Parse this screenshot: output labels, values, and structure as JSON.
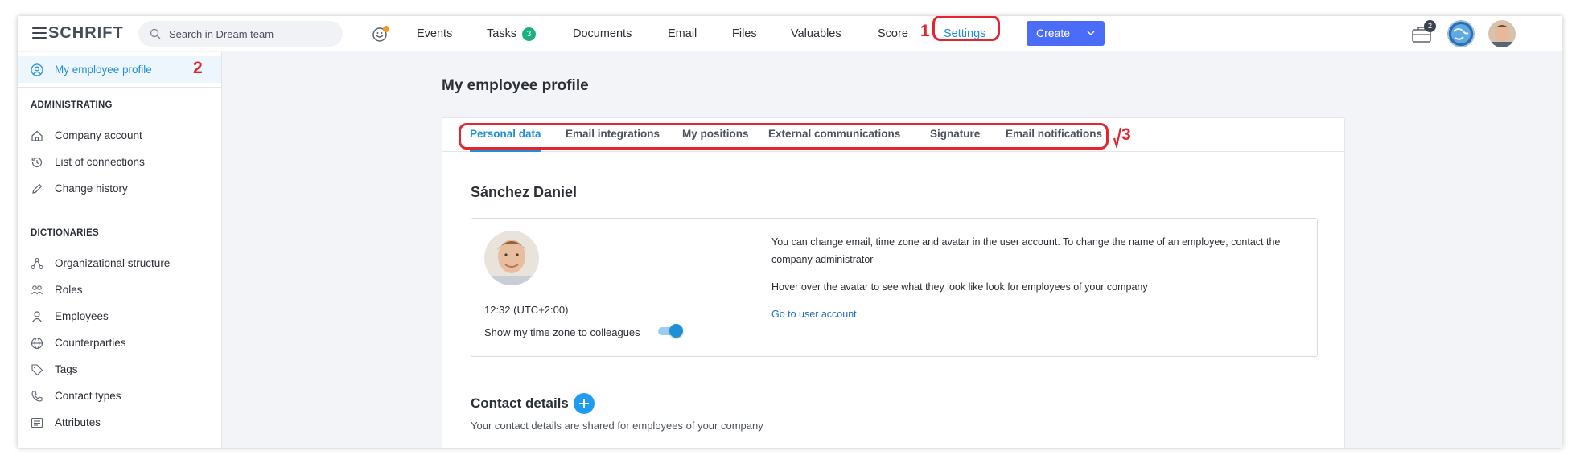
{
  "app": {
    "logo": "SCHRIFT"
  },
  "search": {
    "placeholder": "Search in Dream team"
  },
  "nav": [
    {
      "label": "Events"
    },
    {
      "label": "Tasks",
      "badge": "3"
    },
    {
      "label": "Documents"
    },
    {
      "label": "Email"
    },
    {
      "label": "Files"
    },
    {
      "label": "Valuables"
    },
    {
      "label": "Score"
    },
    {
      "label": "Settings",
      "active": true
    }
  ],
  "create_button": {
    "label": "Create"
  },
  "tray": {
    "badge": "2"
  },
  "annotations": {
    "n1": "1",
    "n2": "2",
    "n3": "3"
  },
  "sidebar": {
    "profile": {
      "label": "My employee profile",
      "icon": "user-circle-icon"
    },
    "sections": [
      {
        "title": "ADMINISTRATING",
        "items": [
          {
            "label": "Company account",
            "icon": "home-icon"
          },
          {
            "label": "List of connections",
            "icon": "history-icon"
          },
          {
            "label": "Change history",
            "icon": "pencil-icon"
          }
        ]
      },
      {
        "title": "DICTIONARIES",
        "items": [
          {
            "label": "Organizational structure",
            "icon": "org-structure-icon"
          },
          {
            "label": "Roles",
            "icon": "roles-icon"
          },
          {
            "label": "Employees",
            "icon": "person-icon"
          },
          {
            "label": "Counterparties",
            "icon": "globe-icon"
          },
          {
            "label": "Tags",
            "icon": "tag-icon"
          },
          {
            "label": "Contact types",
            "icon": "phone-icon"
          },
          {
            "label": "Attributes",
            "icon": "attributes-icon"
          }
        ]
      }
    ]
  },
  "main": {
    "title": "My employee profile",
    "tabs": [
      {
        "label": "Personal data",
        "active": true
      },
      {
        "label": "Email integrations"
      },
      {
        "label": "My positions"
      },
      {
        "label": "External communications"
      },
      {
        "label": "Signature"
      },
      {
        "label": "Email notifications"
      }
    ],
    "employee_name": "Sánchez Daniel",
    "time": "12:32 (UTC+2:00)",
    "show_timezone_label": "Show my time zone to colleagues",
    "show_timezone_enabled": true,
    "note_1": "You can change email, time zone and avatar in the user account. To change the name of an employee, contact the company administrator",
    "note_2": "Hover over the avatar to see what they look like look for employees of your company",
    "user_account_link": "Go to user account",
    "contact_title": "Contact details",
    "contact_subtitle": "Your contact details are shared for employees of your company"
  },
  "colors": {
    "accent": "#1f8fd6",
    "create_button": "#4a6cf7",
    "annotation": "#e22530",
    "badge": "#1bb07d"
  }
}
